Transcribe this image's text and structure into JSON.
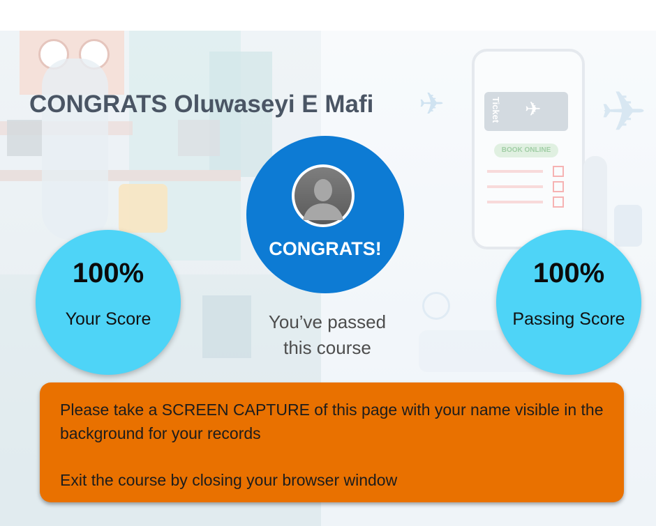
{
  "header": {
    "title": "CONGRATS Oluwaseyi E Mafi"
  },
  "badge": {
    "label": "CONGRATS!",
    "color": "#0d7bd4",
    "avatar_icon": "user-silhouette-icon"
  },
  "your_score": {
    "value": "100%",
    "label": "Your Score",
    "color": "#4ed4f7"
  },
  "passing_score": {
    "value": "100%",
    "label": "Passing Score",
    "color": "#4ed4f7"
  },
  "status_message": "You’ve passed this course",
  "notice": {
    "capture_instruction": "Please take a SCREEN CAPTURE of this page with your name visible in the background for your records",
    "exit_instruction": "Exit the course by closing your browser window",
    "color": "#e97100"
  },
  "illustration": {
    "ticket_text": "Ticket",
    "book_button": "BOOK ONLINE"
  }
}
